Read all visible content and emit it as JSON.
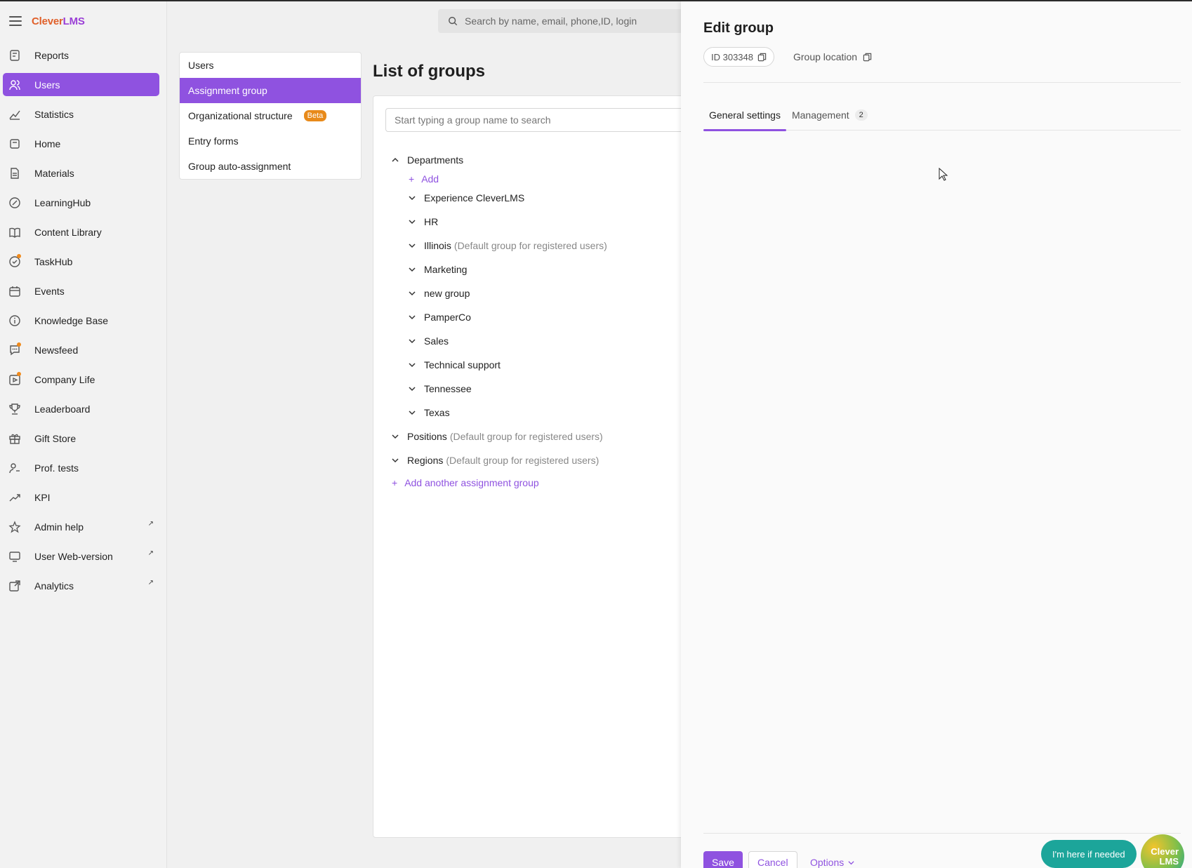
{
  "app": {
    "logo_main": "Clever",
    "logo_accent": "LMS"
  },
  "top_search": {
    "placeholder": "Search by name, email, phone,ID, login"
  },
  "sidebar": {
    "items": [
      {
        "label": "Reports",
        "icon": "reports-icon"
      },
      {
        "label": "Users",
        "icon": "users-icon",
        "active": true
      },
      {
        "label": "Statistics",
        "icon": "statistics-icon"
      },
      {
        "label": "Home",
        "icon": "home-icon"
      },
      {
        "label": "Materials",
        "icon": "materials-icon"
      },
      {
        "label": "LearningHub",
        "icon": "learninghub-icon"
      },
      {
        "label": "Content Library",
        "icon": "book-icon"
      },
      {
        "label": "TaskHub",
        "icon": "taskhub-icon",
        "dot": true
      },
      {
        "label": "Events",
        "icon": "calendar-icon"
      },
      {
        "label": "Knowledge Base",
        "icon": "info-icon"
      },
      {
        "label": "Newsfeed",
        "icon": "chat-icon",
        "dot": true
      },
      {
        "label": "Company Life",
        "icon": "company-life-icon",
        "dot": true
      },
      {
        "label": "Leaderboard",
        "icon": "trophy-icon"
      },
      {
        "label": "Gift Store",
        "icon": "gift-icon"
      },
      {
        "label": "Prof. tests",
        "icon": "prof-tests-icon"
      },
      {
        "label": "KPI",
        "icon": "trend-icon"
      },
      {
        "label": "Admin help",
        "icon": "star-icon",
        "external": true
      },
      {
        "label": "User Web-version",
        "icon": "monitor-icon",
        "external": true
      },
      {
        "label": "Analytics",
        "icon": "analytics-icon",
        "external": true
      }
    ],
    "external_glyph": "↗"
  },
  "subnav": {
    "items": [
      {
        "label": "Users"
      },
      {
        "label": "Assignment group",
        "active": true
      },
      {
        "label": "Organizational structure",
        "badge": "Beta"
      },
      {
        "label": "Entry forms"
      },
      {
        "label": "Group auto-assignment"
      }
    ]
  },
  "groups": {
    "title": "List of groups",
    "search_placeholder": "Start typing a group name to search",
    "departments_label": "Departments",
    "add_label": "Add",
    "departments": [
      {
        "name": "Experience CleverLMS",
        "note": ""
      },
      {
        "name": "HR",
        "note": ""
      },
      {
        "name": "Illinois",
        "note": "(Default group for registered users)"
      },
      {
        "name": "Marketing",
        "note": ""
      },
      {
        "name": "new group",
        "note": ""
      },
      {
        "name": "PamperCo",
        "note": ""
      },
      {
        "name": "Sales",
        "note": ""
      },
      {
        "name": "Technical support",
        "note": ""
      },
      {
        "name": "Tennessee",
        "note": ""
      },
      {
        "name": "Texas",
        "note": ""
      }
    ],
    "other_groups": [
      {
        "name": "Positions",
        "note": "(Default group for registered users)"
      },
      {
        "name": "Regions",
        "note": "(Default group for registered users)"
      }
    ],
    "add_another_label": "Add another assignment group"
  },
  "drawer": {
    "title": "Edit group",
    "id_label": "ID 303348",
    "location_label": "Group location",
    "tabs": [
      {
        "label": "General settings",
        "active": true
      },
      {
        "label": "Management",
        "count": "2"
      }
    ],
    "save_label": "Save",
    "cancel_label": "Cancel",
    "options_label": "Options",
    "help_label": "I'm here if needed",
    "badge_line1": "Clever",
    "badge_line2": "LMS"
  },
  "colors": {
    "accent": "#8f52e0",
    "beta": "#e88a1a",
    "help": "#1ca59a",
    "dot": "#f08a1c"
  }
}
